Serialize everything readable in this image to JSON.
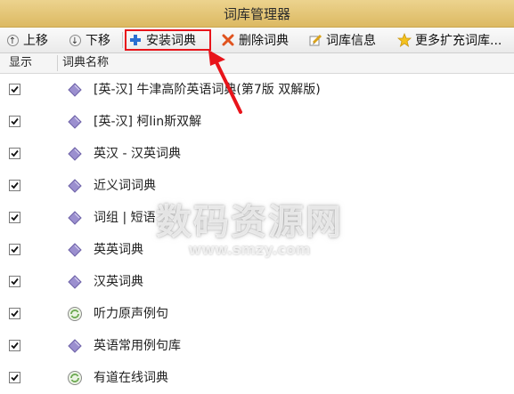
{
  "window": {
    "title": "词库管理器"
  },
  "toolbar": {
    "move_up": "上移",
    "move_down": "下移",
    "install": "安装词典",
    "delete": "删除词典",
    "info": "词库信息",
    "more": "更多扩充词库..."
  },
  "columns": {
    "show": "显示",
    "name": "词典名称"
  },
  "dictionaries": [
    {
      "name": "[英-汉] 牛津高阶英语词典(第7版 双解版)",
      "icon": "diamond-book-icon",
      "checked": true
    },
    {
      "name": "[英-汉] 柯lin斯双解",
      "icon": "diamond-book-icon",
      "checked": true
    },
    {
      "name": "英汉 - 汉英词典",
      "icon": "diamond-book-icon",
      "checked": true
    },
    {
      "name": "近义词词典",
      "icon": "diamond-book-icon",
      "checked": true
    },
    {
      "name": "词组 | 短语",
      "icon": "diamond-book-icon",
      "checked": true
    },
    {
      "name": "英英词典",
      "icon": "diamond-book-icon",
      "checked": true
    },
    {
      "name": "汉英词典",
      "icon": "diamond-book-icon",
      "checked": true
    },
    {
      "name": "听力原声例句",
      "icon": "audio-refresh-icon",
      "checked": true
    },
    {
      "name": "英语常用例句库",
      "icon": "diamond-book-icon",
      "checked": true
    },
    {
      "name": "有道在线词典",
      "icon": "audio-refresh-icon",
      "checked": true
    }
  ],
  "watermark": {
    "main": "数码资源网",
    "sub": "www.smzy.com"
  },
  "colors": {
    "highlight": "#e8141b",
    "titlebar": "#e3c476",
    "diamond": "#9b8fcf",
    "refresh": "#6aa84f"
  }
}
